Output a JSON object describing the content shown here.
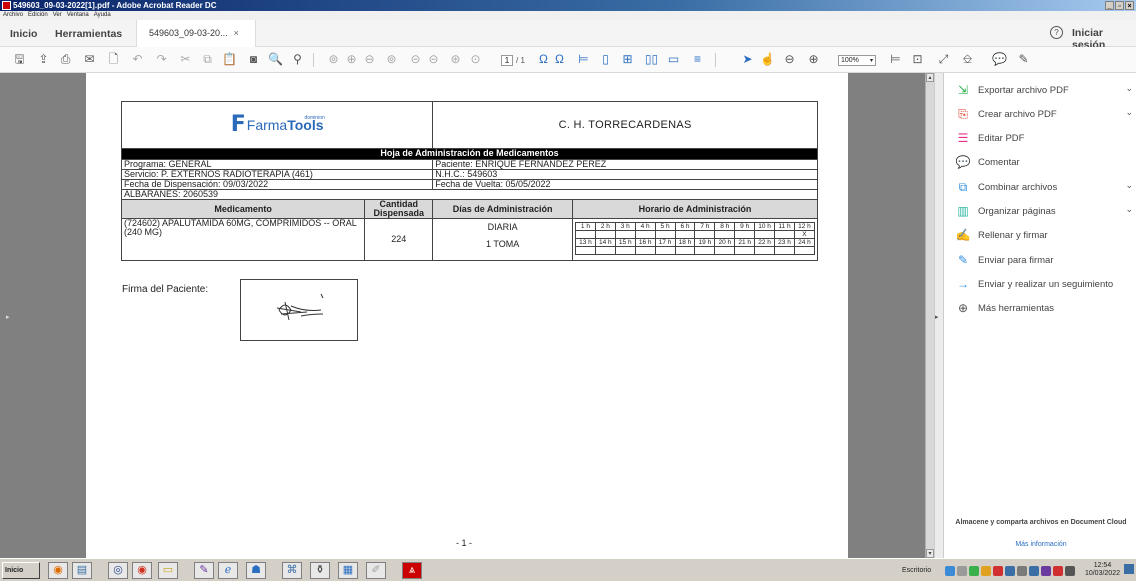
{
  "window": {
    "title": "549603_09-03-2022[1].pdf - Adobe Acrobat Reader DC"
  },
  "menu": [
    "Archivo",
    "Edición",
    "Ver",
    "Ventana",
    "Ayuda"
  ],
  "tabs": {
    "home": "Inicio",
    "tools": "Herramientas",
    "document": "549603_09-03-20...",
    "signin": "Iniciar sesión"
  },
  "toolbar": {
    "page_current": "1",
    "page_total": "/ 1",
    "zoom": "100%"
  },
  "document": {
    "logo": {
      "farma": "Farma",
      "tools": "Tools",
      "tagline": "dominion"
    },
    "hospital": "C. H. TORRECARDENAS",
    "sheet_title": "Hoja de Administración de Medicamentos",
    "programa": "Programa: GENERAL",
    "paciente": "Paciente: ENRIQUE FERNANDEZ PEREZ",
    "servicio": "Servicio: P. EXTERNOS RADIOTERAPIA (461)",
    "nhc": "N.H.C.: 549603",
    "fecha_dispensacion": "Fecha de Dispensación: 09/03/2022",
    "fecha_vuelta": "Fecha de Vuelta: 05/05/2022",
    "albaranes": "ALBARANES: 2060539",
    "columns": {
      "medicamento": "Medicamento",
      "cantidad": "Cantidad Dispensada",
      "dias": "Días de Administración",
      "horario": "Horario de Administración"
    },
    "row": {
      "medicamento": "(724602) APALUTAMIDA 60MG, COMPRIMIDOS -- ORAL (240 MG)",
      "cantidad": "224",
      "dias": "DIARIA",
      "tomas": "1 TOMA"
    },
    "hours_am": [
      "1 h",
      "2 h",
      "3 h",
      "4 h",
      "5 h",
      "6 h",
      "7 h",
      "8 h",
      "9 h",
      "10 h",
      "11 h",
      "12 h"
    ],
    "hours_am_marks": [
      "",
      "",
      "",
      "",
      "",
      "",
      "",
      "",
      "",
      "",
      "",
      "X"
    ],
    "hours_pm": [
      "13 h",
      "14 h",
      "15 h",
      "16 h",
      "17 h",
      "18 h",
      "19 h",
      "20 h",
      "21 h",
      "22 h",
      "23 h",
      "24 h"
    ],
    "firma_label": "Firma del Paciente:",
    "page_number": "- 1 -"
  },
  "tools_panel": {
    "items": [
      {
        "label": "Exportar archivo PDF",
        "icon": "export-pdf-icon",
        "color": "#2db14b",
        "expandable": true
      },
      {
        "label": "Crear archivo PDF",
        "icon": "create-pdf-icon",
        "color": "#e0301e",
        "expandable": true
      },
      {
        "label": "Editar PDF",
        "icon": "edit-pdf-icon",
        "color": "#e8308a",
        "expandable": false
      },
      {
        "label": "Comentar",
        "icon": "comment-icon",
        "color": "#f4b400",
        "expandable": false
      },
      {
        "label": "Combinar archivos",
        "icon": "combine-files-icon",
        "color": "#2f8ee0",
        "expandable": true
      },
      {
        "label": "Organizar páginas",
        "icon": "organize-pages-icon",
        "color": "#2bb5a0",
        "expandable": true
      },
      {
        "label": "Rellenar y firmar",
        "icon": "fill-sign-icon",
        "color": "#6a5acd",
        "expandable": false
      },
      {
        "label": "Enviar para firmar",
        "icon": "send-for-signature-icon",
        "color": "#2f8ee0",
        "expandable": false
      },
      {
        "label": "Enviar y realizar un seguimiento",
        "icon": "send-track-icon",
        "color": "#2f8ee0",
        "expandable": false
      },
      {
        "label": "Más herramientas",
        "icon": "more-tools-icon",
        "color": "#555555",
        "expandable": false
      }
    ],
    "cloud_text": "Almacene y comparta archivos en Document Cloud",
    "more_info": "Más información"
  },
  "taskbar": {
    "start": "Inicio",
    "tray_label": "Escritorio",
    "time": "12:54",
    "date": "10/03/2022"
  }
}
